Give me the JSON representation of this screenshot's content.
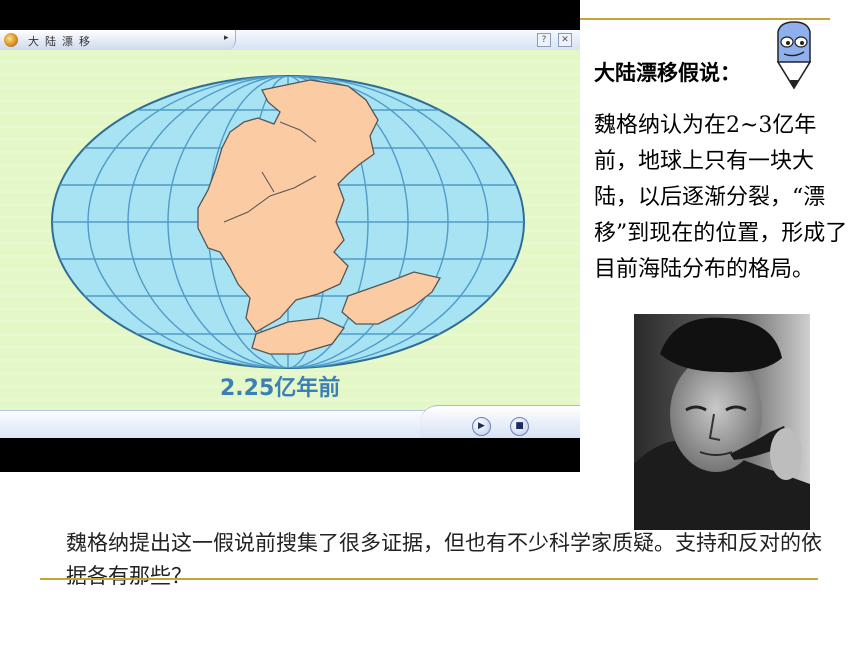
{
  "player": {
    "title": "大陆漂移",
    "menu_arrow": "▸",
    "help": "?",
    "close": "✕",
    "date_label": "2.25亿年前",
    "play": "▶",
    "stop": "■"
  },
  "slide": {
    "heading": "大陆漂移假说：",
    "body": "魏格纳认为在2~3亿年前，地球上只有一块大陆，以后逐渐分裂，“漂移”到现在的位置，形成了目前海陆分布的格局。",
    "question": "魏格纳提出这一假说前搜集了很多证据，但也有不少科学家质疑。支持和反对的依据各有那些？"
  },
  "colors": {
    "ocean": "#a8e3f4",
    "land": "#fbcba4",
    "grid": "#4f9bc8",
    "accent_line": "#c6a33a",
    "stage_bg": "#e4f7c6"
  }
}
